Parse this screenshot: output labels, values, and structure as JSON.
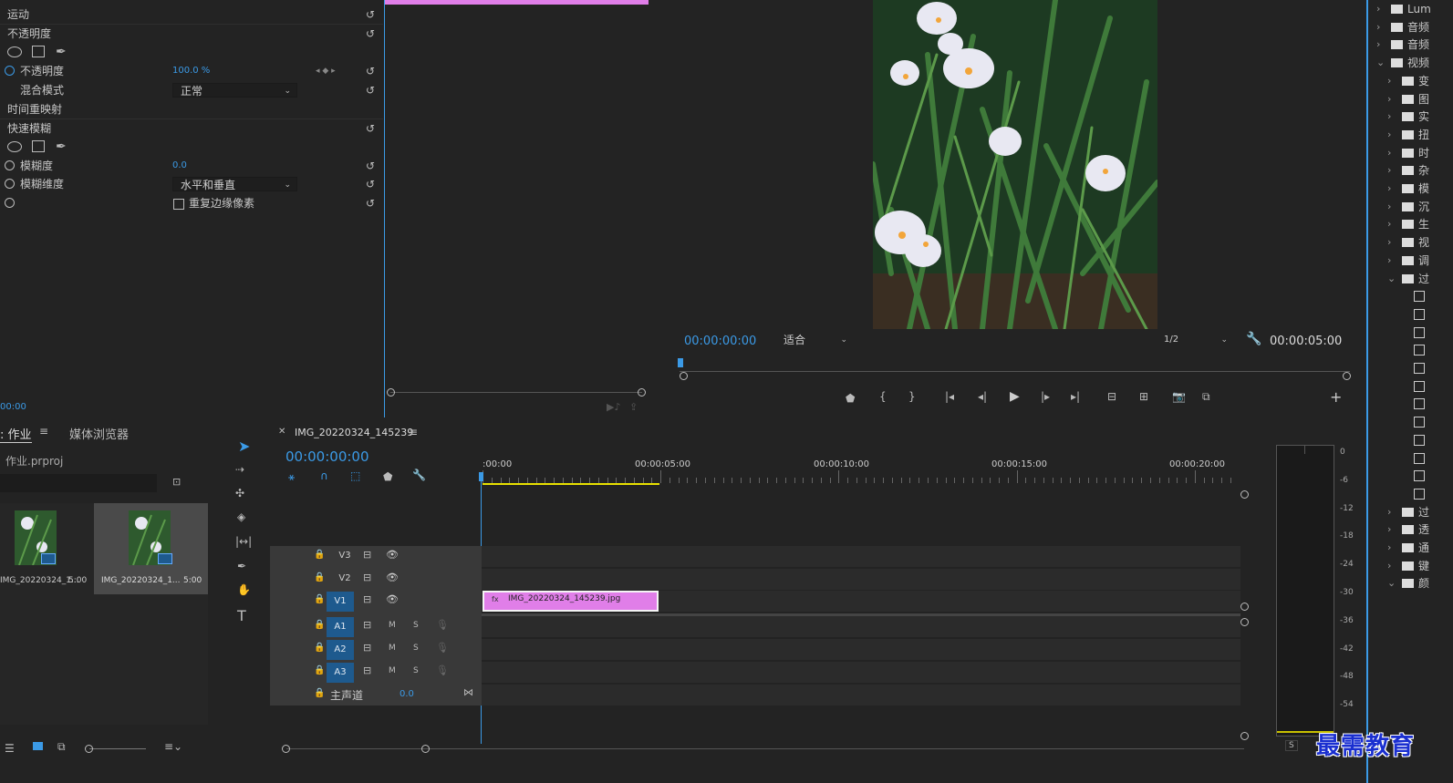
{
  "effect_controls": {
    "rows": [
      {
        "label": "运动"
      },
      {
        "label": "不透明度"
      },
      {
        "label": "不透明度",
        "value": "100.0 %"
      },
      {
        "label": "混合模式",
        "value": "正常"
      },
      {
        "label": "时间重映射"
      },
      {
        "label": "快速模糊"
      },
      {
        "label": "模糊度",
        "value": "0.0"
      },
      {
        "label": "模糊维度",
        "value": "水平和垂直"
      },
      {
        "label": "",
        "checkbox": "重复边缘像素"
      }
    ],
    "timecode": "00:00"
  },
  "program_monitor": {
    "timecode_left": "00:00:00:00",
    "fit": "适合",
    "resolution": "1/2",
    "timecode_right": "00:00:05:00"
  },
  "project": {
    "tab_project": "作业",
    "tab_media": "媒体浏览器",
    "file": "作业.prproj",
    "items": [
      {
        "name": "IMG_20220324_1...",
        "duration": "5:00"
      },
      {
        "name": "IMG_20220324_1...",
        "duration": "5:00"
      }
    ]
  },
  "timeline": {
    "tab": "IMG_20220324_145239",
    "timecode": "00:00:00:00",
    "ruler": [
      ":00:00",
      "00:00:05:00",
      "00:00:10:00",
      "00:00:15:00",
      "00:00:20:00"
    ],
    "video_tracks": [
      "V3",
      "V2",
      "V1"
    ],
    "audio_tracks": [
      "A1",
      "A2",
      "A3"
    ],
    "master_label": "主声道",
    "master_value": "0.0",
    "clip": "IMG_20220324_145239.jpg",
    "m": "M",
    "s": "S"
  },
  "meter": {
    "labels": [
      "0",
      "-6",
      "-12",
      "-18",
      "-24",
      "-30",
      "-36",
      "-42",
      "-48",
      "-54"
    ],
    "s_btn": "S"
  },
  "effects_tree": {
    "items": [
      "Lum",
      "音频",
      "音频",
      "视频",
      "变",
      "图",
      "实",
      "扭",
      "时",
      "杂",
      "模",
      "沉",
      "生",
      "视",
      "调",
      "过",
      "",
      "",
      "",
      "",
      "",
      "",
      "",
      "",
      "",
      "",
      "",
      "",
      "过",
      "透",
      "通",
      "键",
      "颜"
    ]
  },
  "watermark": "最需教育",
  "colors": {
    "accent": "#3b9ae6",
    "clip": "#e07ee8",
    "work_area": "#e8e100",
    "track_btn": "#1e5a8e"
  }
}
